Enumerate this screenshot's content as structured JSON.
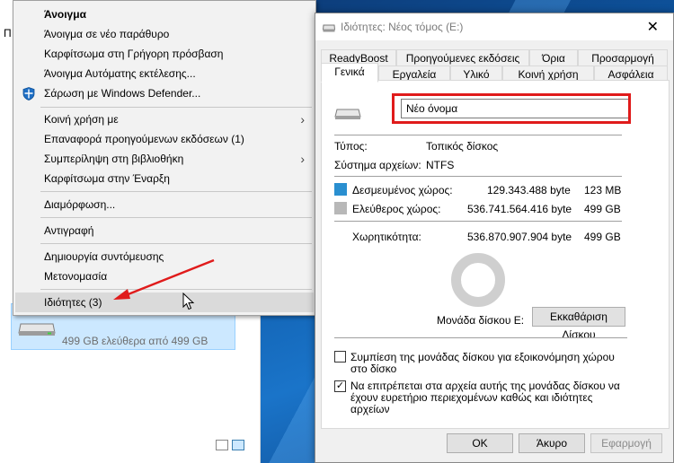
{
  "explorer": {
    "top_label": "Π",
    "drive_free_text": "499 GB ελεύθερα από 499 GB"
  },
  "context_menu": {
    "items": [
      {
        "label": "Άνοιγμα"
      },
      {
        "label": "Άνοιγμα σε νέο παράθυρο"
      },
      {
        "label": "Καρφίτσωμα στη Γρήγορη πρόσβαση"
      },
      {
        "label": "Άνοιγμα Αυτόματης εκτέλεσης..."
      },
      {
        "label": "Σάρωση με Windows Defender..."
      },
      {
        "label": "Κοινή χρήση με"
      },
      {
        "label": "Επαναφορά προηγούμενων εκδόσεων (1)"
      },
      {
        "label": "Συμπερίληψη στη βιβλιοθήκη"
      },
      {
        "label": "Καρφίτσωμα στην Έναρξη"
      },
      {
        "label": "Διαμόρφωση..."
      },
      {
        "label": "Αντιγραφή"
      },
      {
        "label": "Δημιουργία συντόμευσης"
      },
      {
        "label": "Μετονομασία"
      },
      {
        "label": "Ιδιότητες (3)"
      }
    ]
  },
  "dialog": {
    "title": "Ιδιότητες: Νέος τόμος (E:)",
    "close_glyph": "✕",
    "tabs_row1": [
      "ReadyBoost",
      "Προηγούμενες εκδόσεις",
      "Όρια",
      "Προσαρμογή"
    ],
    "tabs_row2": [
      "Γενικά",
      "Εργαλεία",
      "Υλικό",
      "Κοινή χρήση",
      "Ασφάλεια"
    ],
    "name_value": "Νέο όνομα",
    "type_label": "Τύπος:",
    "type_value": "Τοπικός δίσκος",
    "fs_label": "Σύστημα αρχείων:",
    "fs_value": "NTFS",
    "used_label": "Δεσμευμένος χώρος:",
    "used_bytes": "129.343.488 byte",
    "used_size": "123 MB",
    "free_label": "Ελεύθερος χώρος:",
    "free_bytes": "536.741.564.416 byte",
    "free_size": "499 GB",
    "cap_label": "Χωρητικότητα:",
    "cap_bytes": "536.870.907.904 byte",
    "cap_size": "499 GB",
    "drive_label": "Μονάδα δίσκου E:",
    "cleanup_button": "Εκκαθάριση Δίσκου",
    "compress_label": "Συμπίεση της μονάδας δίσκου για εξοικονόμηση χώρου στο δίσκο",
    "compress_checked": false,
    "index_label": "Να επιτρέπεται στα αρχεία αυτής της μονάδας δίσκου να έχουν ευρετήριο περιεχομένων καθώς και ιδιότητες αρχείων",
    "index_checked": true,
    "check_glyph": "✓",
    "ok_button": "OK",
    "cancel_button": "Άκυρο",
    "apply_button": "Εφαρμογή"
  },
  "colors": {
    "used_space": "#2a8fd0",
    "free_space": "#b8b8b8",
    "highlight_frame": "#e01b1b",
    "annotation_arrow": "#e01b1b"
  },
  "icons": {
    "shield": "windows-defender-shield-icon",
    "submenu": "chevron-right-icon",
    "drive": "hard-drive-icon",
    "cursor": "mouse-pointer-icon"
  }
}
